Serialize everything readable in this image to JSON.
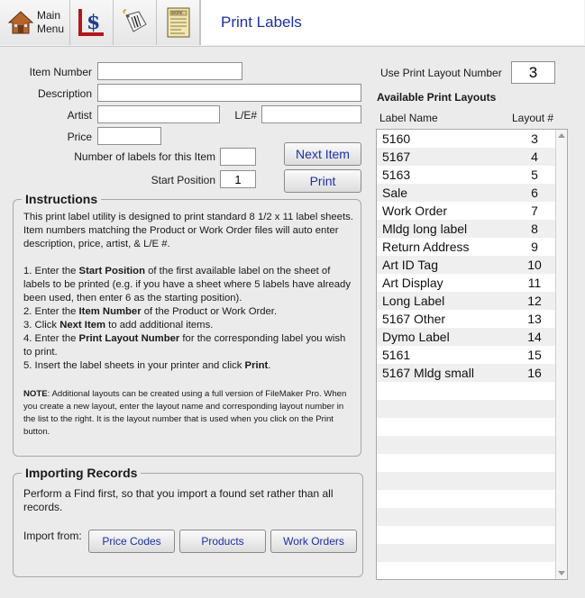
{
  "toolbar": {
    "main_menu_line1": "Main",
    "main_menu_line2": "Menu",
    "title": "Print Labels"
  },
  "form": {
    "item_number_label": "Item Number",
    "description_label": "Description",
    "artist_label": "Artist",
    "le_label": "L/E#",
    "price_label": "Price",
    "num_labels_label": "Number of labels for this Item",
    "start_position_label": "Start Position",
    "start_position_value": "1",
    "next_item_button": "Next Item",
    "print_button": "Print"
  },
  "layout_select": {
    "label": "Use Print Layout Number",
    "value": "3",
    "heading": "Available Print Layouts",
    "col_name": "Label Name",
    "col_num": "Layout #",
    "rows": [
      {
        "name": "5160",
        "num": "3"
      },
      {
        "name": "5167",
        "num": "4"
      },
      {
        "name": "5163",
        "num": "5"
      },
      {
        "name": "Sale",
        "num": "6"
      },
      {
        "name": "Work Order",
        "num": "7"
      },
      {
        "name": "Mldg long label",
        "num": "8"
      },
      {
        "name": "Return Address",
        "num": "9"
      },
      {
        "name": "Art ID Tag",
        "num": "10"
      },
      {
        "name": "Art Display",
        "num": "11"
      },
      {
        "name": "Long Label",
        "num": "12"
      },
      {
        "name": "5167 Other",
        "num": "13"
      },
      {
        "name": "Dymo Label",
        "num": "14"
      },
      {
        "name": "5161",
        "num": "15"
      },
      {
        "name": "5167 Mldg small",
        "num": "16"
      }
    ]
  },
  "instructions": {
    "title": "Instructions",
    "intro": "This print label utility is designed to print standard 8 1/2 x 11 label sheets. Item numbers matching the Product or Work Order files will auto enter description, price, artist, & L/E #.",
    "s1a": "1. Enter the ",
    "s1b": "Start Position",
    "s1c": " of the first available label on the sheet of labels to be printed (e.g. if you have a sheet where 5 labels have already been used, then enter 6 as the starting position).",
    "s2a": "2. Enter the ",
    "s2b": "Item Number",
    "s2c": " of the Product or Work Order.",
    "s3a": "3. Click ",
    "s3b": "Next Item",
    "s3c": " to add additional items.",
    "s4a": "4. Enter the ",
    "s4b": "Print Layout Number",
    "s4c": " for the corresponding label you wish to print.",
    "s5a": "5. Insert the label sheets in your printer and click ",
    "s5b": "Print",
    "s5c": ".",
    "note_label": "NOTE",
    "note_text": ": Additional layouts can be created using a full version of FileMaker Pro. When you create a new layout, enter the layout name and corresponding layout number in the list to the right. It is the layout number that is used when you click on the Print button."
  },
  "importing": {
    "title": "Importing Records",
    "text": "Perform a Find first, so that you import a found set rather than all records.",
    "import_from_label": "Import from:",
    "price_codes_button": "Price Codes",
    "products_button": "Products",
    "work_orders_button": "Work Orders"
  }
}
